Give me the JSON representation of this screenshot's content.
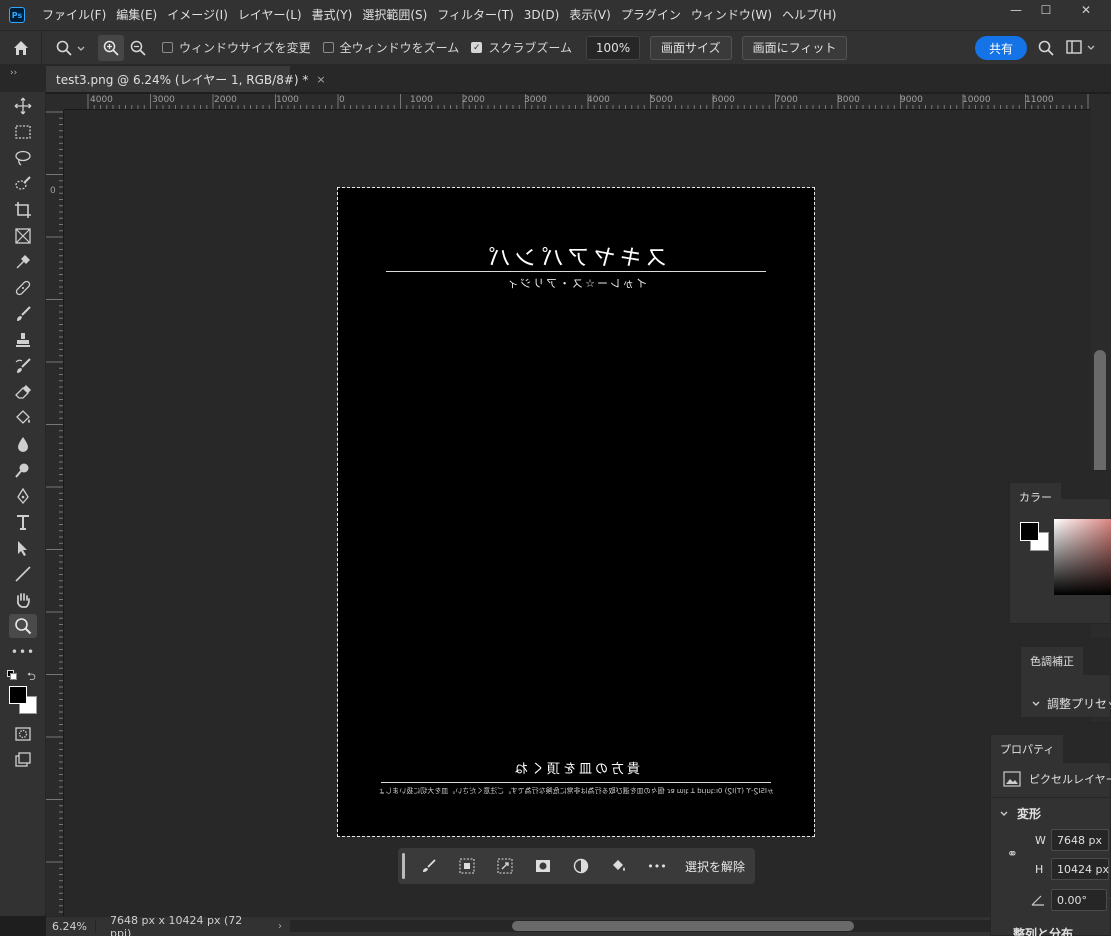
{
  "app": {
    "logo": "Ps"
  },
  "menu": [
    "ファイル(F)",
    "編集(E)",
    "イメージ(I)",
    "レイヤー(L)",
    "書式(Y)",
    "選択範囲(S)",
    "フィルター(T)",
    "3D(D)",
    "表示(V)",
    "プラグイン",
    "ウィンドウ(W)",
    "ヘルプ(H)"
  ],
  "window_controls": {
    "minimize": "—",
    "maximize": "☐",
    "close": "✕"
  },
  "options": {
    "resize_windows": "ウィンドウサイズを変更",
    "zoom_all_windows": "全ウィンドウをズーム",
    "scrubby_zoom": "スクラブズーム",
    "zoom_value": "100%",
    "fit_screen_size": "画面サイズ",
    "fit_screen": "画面にフィット",
    "share": "共有",
    "resize_windows_checked": false,
    "zoom_all_windows_checked": false,
    "scrubby_zoom_checked": true
  },
  "tab": {
    "title": "test3.png @ 6.24% (レイヤー 1, RGB/8#) *",
    "close": "×"
  },
  "ruler_h": [
    "4000",
    "3000",
    "2000",
    "1000",
    "0",
    "1000",
    "2000",
    "3000",
    "4000",
    "5000",
    "6000",
    "7000",
    "8000",
    "9000",
    "10000",
    "11000"
  ],
  "ruler_v": [
    "0"
  ],
  "document": {
    "title": "スキヤアパンパ",
    "subtitle": "イゕレー☆ス・アリジィ",
    "footer_title": "貴方の皿を頂くね",
    "footer_note": "ゕISIϨ-ϒ (T)IϨ) 0ı:ʇuᴉɹd ꓕ ʇᴉɯ ɐɾ   個々の皿を選び取る行為は非常に危険な行為です。ご注意ください。皿を大切に扱いましょう。"
  },
  "taskbar": {
    "deselect": "選択を解除",
    "more": "•••"
  },
  "status": {
    "zoom": "6.24%",
    "doc_info": "7648 px x 10424 px (72 ppi)",
    "arrow": "›",
    "back": "‹"
  },
  "panels": {
    "color": {
      "tab": "カラー"
    },
    "adjustments": {
      "tab": "色調補正",
      "presets": "調整プリセット"
    },
    "properties": {
      "tab": "プロパティ",
      "layer_type": "ピクセルレイヤー",
      "transform": "変形",
      "w_label": "W",
      "w_value": "7648 px",
      "h_label": "H",
      "h_value": "10424 px",
      "angle_value": "0.00°",
      "align_cut": "整列と分布"
    }
  }
}
